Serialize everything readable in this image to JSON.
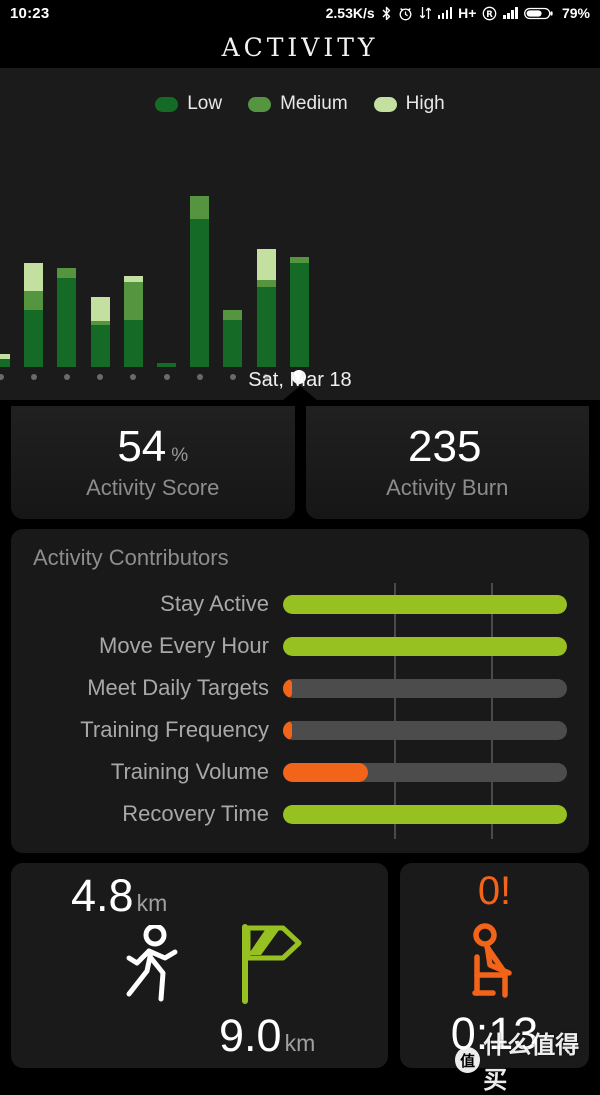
{
  "status_bar": {
    "clock": "10:23",
    "network_speed": "2.53K/s",
    "battery": "79%",
    "network_type": "H+",
    "icons": [
      "bluetooth-icon",
      "alarm-icon",
      "data-transfer-icon",
      "signal-bars-icon",
      "roaming-icon",
      "signal-bars-icon",
      "battery-icon"
    ]
  },
  "header": {
    "title": "ACTIVITY"
  },
  "legend": {
    "items": [
      {
        "label": "Low",
        "color": "#156b26"
      },
      {
        "label": "Medium",
        "color": "#56953f"
      },
      {
        "label": "High",
        "color": "#c3e0a0"
      }
    ]
  },
  "chart_data": {
    "type": "bar",
    "title": "",
    "xlabel": "",
    "ylabel": "",
    "stacked": true,
    "selected_index": 9,
    "selected_label": "Sat, Mar 18",
    "categories": [
      "",
      "",
      "",
      "",
      "",
      "",
      "",
      "",
      "",
      ""
    ],
    "series": [
      {
        "name": "Low",
        "color": "#156b26",
        "values": [
          4,
          30,
          47,
          22,
          25,
          2,
          78,
          25,
          42,
          55
        ]
      },
      {
        "name": "Medium",
        "color": "#56953f",
        "values": [
          0,
          10,
          5,
          2,
          20,
          0,
          12,
          5,
          4,
          3
        ]
      },
      {
        "name": "High",
        "color": "#c3e0a0",
        "values": [
          3,
          15,
          0,
          13,
          3,
          0,
          0,
          0,
          16,
          0
        ]
      }
    ],
    "ylim": [
      0,
      100
    ],
    "grid": false,
    "legend_position": "top"
  },
  "stats": [
    {
      "value": "54",
      "unit": "%",
      "label": "Activity Score"
    },
    {
      "value": "235",
      "unit": "",
      "label": "Activity Burn"
    }
  ],
  "contributors": {
    "title": "Activity Contributors",
    "complete_color": "#96c121",
    "incomplete_color": "#f26419",
    "track_color": "#4c4c4c",
    "rows": [
      {
        "label": "Stay Active",
        "percent": 100,
        "color": "#96c121"
      },
      {
        "label": "Move Every Hour",
        "percent": 100,
        "color": "#96c121"
      },
      {
        "label": "Meet Daily Targets",
        "percent": 3,
        "color": "#f26419"
      },
      {
        "label": "Training Frequency",
        "percent": 3,
        "color": "#f26419"
      },
      {
        "label": "Training Volume",
        "percent": 30,
        "color": "#f26419"
      },
      {
        "label": "Recovery Time",
        "percent": 100,
        "color": "#96c121"
      }
    ]
  },
  "distance_card": {
    "walk_value": "4.8",
    "walk_unit": "km",
    "walk_icon": "running-person-icon",
    "goal_value": "9.0",
    "goal_unit": "km",
    "goal_icon": "flag-icon",
    "goal_color": "#96c121"
  },
  "inactivity_card": {
    "alert": "0!",
    "alert_color": "#f26419",
    "icon": "sitting-person-icon",
    "duration": "0:13"
  },
  "watermark": {
    "logo": "值",
    "text": "什么值得买"
  }
}
